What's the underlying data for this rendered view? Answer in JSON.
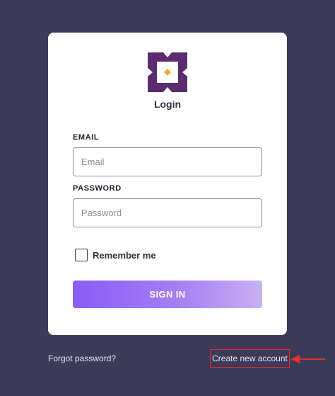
{
  "login": {
    "title": "Login",
    "email_label": "EMAIL",
    "email_placeholder": "Email",
    "email_value": "",
    "password_label": "PASSWORD",
    "password_placeholder": "Password",
    "password_value": "",
    "remember_label": "Remember me",
    "sign_in_label": "SIGN IN"
  },
  "footer": {
    "forgot_label": "Forgot password?",
    "create_label": "Create new account"
  },
  "colors": {
    "background": "#3b3b58",
    "logo_purple": "#5b2d6e",
    "logo_accent": "#f2a93b",
    "button_start": "#8a5cf5",
    "button_end": "#c7b1f2",
    "highlight_red": "#e52d2d"
  },
  "icons": {
    "logo": "square-cross-logo",
    "annotation": "red-arrow-left"
  }
}
